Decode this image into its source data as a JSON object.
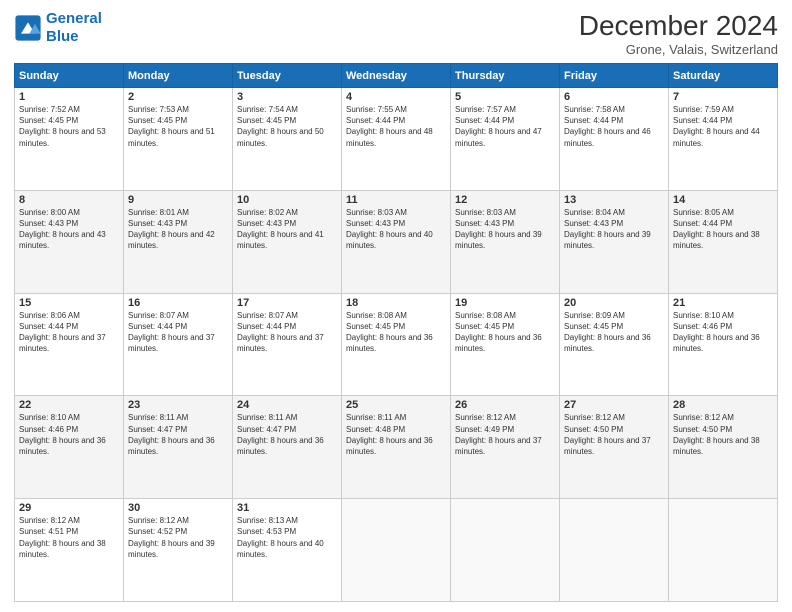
{
  "logo": {
    "line1": "General",
    "line2": "Blue"
  },
  "title": "December 2024",
  "subtitle": "Grone, Valais, Switzerland",
  "days_header": [
    "Sunday",
    "Monday",
    "Tuesday",
    "Wednesday",
    "Thursday",
    "Friday",
    "Saturday"
  ],
  "weeks": [
    [
      {
        "num": "1",
        "sunrise": "Sunrise: 7:52 AM",
        "sunset": "Sunset: 4:45 PM",
        "daylight": "Daylight: 8 hours and 53 minutes."
      },
      {
        "num": "2",
        "sunrise": "Sunrise: 7:53 AM",
        "sunset": "Sunset: 4:45 PM",
        "daylight": "Daylight: 8 hours and 51 minutes."
      },
      {
        "num": "3",
        "sunrise": "Sunrise: 7:54 AM",
        "sunset": "Sunset: 4:45 PM",
        "daylight": "Daylight: 8 hours and 50 minutes."
      },
      {
        "num": "4",
        "sunrise": "Sunrise: 7:55 AM",
        "sunset": "Sunset: 4:44 PM",
        "daylight": "Daylight: 8 hours and 48 minutes."
      },
      {
        "num": "5",
        "sunrise": "Sunrise: 7:57 AM",
        "sunset": "Sunset: 4:44 PM",
        "daylight": "Daylight: 8 hours and 47 minutes."
      },
      {
        "num": "6",
        "sunrise": "Sunrise: 7:58 AM",
        "sunset": "Sunset: 4:44 PM",
        "daylight": "Daylight: 8 hours and 46 minutes."
      },
      {
        "num": "7",
        "sunrise": "Sunrise: 7:59 AM",
        "sunset": "Sunset: 4:44 PM",
        "daylight": "Daylight: 8 hours and 44 minutes."
      }
    ],
    [
      {
        "num": "8",
        "sunrise": "Sunrise: 8:00 AM",
        "sunset": "Sunset: 4:43 PM",
        "daylight": "Daylight: 8 hours and 43 minutes."
      },
      {
        "num": "9",
        "sunrise": "Sunrise: 8:01 AM",
        "sunset": "Sunset: 4:43 PM",
        "daylight": "Daylight: 8 hours and 42 minutes."
      },
      {
        "num": "10",
        "sunrise": "Sunrise: 8:02 AM",
        "sunset": "Sunset: 4:43 PM",
        "daylight": "Daylight: 8 hours and 41 minutes."
      },
      {
        "num": "11",
        "sunrise": "Sunrise: 8:03 AM",
        "sunset": "Sunset: 4:43 PM",
        "daylight": "Daylight: 8 hours and 40 minutes."
      },
      {
        "num": "12",
        "sunrise": "Sunrise: 8:03 AM",
        "sunset": "Sunset: 4:43 PM",
        "daylight": "Daylight: 8 hours and 39 minutes."
      },
      {
        "num": "13",
        "sunrise": "Sunrise: 8:04 AM",
        "sunset": "Sunset: 4:43 PM",
        "daylight": "Daylight: 8 hours and 39 minutes."
      },
      {
        "num": "14",
        "sunrise": "Sunrise: 8:05 AM",
        "sunset": "Sunset: 4:44 PM",
        "daylight": "Daylight: 8 hours and 38 minutes."
      }
    ],
    [
      {
        "num": "15",
        "sunrise": "Sunrise: 8:06 AM",
        "sunset": "Sunset: 4:44 PM",
        "daylight": "Daylight: 8 hours and 37 minutes."
      },
      {
        "num": "16",
        "sunrise": "Sunrise: 8:07 AM",
        "sunset": "Sunset: 4:44 PM",
        "daylight": "Daylight: 8 hours and 37 minutes."
      },
      {
        "num": "17",
        "sunrise": "Sunrise: 8:07 AM",
        "sunset": "Sunset: 4:44 PM",
        "daylight": "Daylight: 8 hours and 37 minutes."
      },
      {
        "num": "18",
        "sunrise": "Sunrise: 8:08 AM",
        "sunset": "Sunset: 4:45 PM",
        "daylight": "Daylight: 8 hours and 36 minutes."
      },
      {
        "num": "19",
        "sunrise": "Sunrise: 8:08 AM",
        "sunset": "Sunset: 4:45 PM",
        "daylight": "Daylight: 8 hours and 36 minutes."
      },
      {
        "num": "20",
        "sunrise": "Sunrise: 8:09 AM",
        "sunset": "Sunset: 4:45 PM",
        "daylight": "Daylight: 8 hours and 36 minutes."
      },
      {
        "num": "21",
        "sunrise": "Sunrise: 8:10 AM",
        "sunset": "Sunset: 4:46 PM",
        "daylight": "Daylight: 8 hours and 36 minutes."
      }
    ],
    [
      {
        "num": "22",
        "sunrise": "Sunrise: 8:10 AM",
        "sunset": "Sunset: 4:46 PM",
        "daylight": "Daylight: 8 hours and 36 minutes."
      },
      {
        "num": "23",
        "sunrise": "Sunrise: 8:11 AM",
        "sunset": "Sunset: 4:47 PM",
        "daylight": "Daylight: 8 hours and 36 minutes."
      },
      {
        "num": "24",
        "sunrise": "Sunrise: 8:11 AM",
        "sunset": "Sunset: 4:47 PM",
        "daylight": "Daylight: 8 hours and 36 minutes."
      },
      {
        "num": "25",
        "sunrise": "Sunrise: 8:11 AM",
        "sunset": "Sunset: 4:48 PM",
        "daylight": "Daylight: 8 hours and 36 minutes."
      },
      {
        "num": "26",
        "sunrise": "Sunrise: 8:12 AM",
        "sunset": "Sunset: 4:49 PM",
        "daylight": "Daylight: 8 hours and 37 minutes."
      },
      {
        "num": "27",
        "sunrise": "Sunrise: 8:12 AM",
        "sunset": "Sunset: 4:50 PM",
        "daylight": "Daylight: 8 hours and 37 minutes."
      },
      {
        "num": "28",
        "sunrise": "Sunrise: 8:12 AM",
        "sunset": "Sunset: 4:50 PM",
        "daylight": "Daylight: 8 hours and 38 minutes."
      }
    ],
    [
      {
        "num": "29",
        "sunrise": "Sunrise: 8:12 AM",
        "sunset": "Sunset: 4:51 PM",
        "daylight": "Daylight: 8 hours and 38 minutes."
      },
      {
        "num": "30",
        "sunrise": "Sunrise: 8:12 AM",
        "sunset": "Sunset: 4:52 PM",
        "daylight": "Daylight: 8 hours and 39 minutes."
      },
      {
        "num": "31",
        "sunrise": "Sunrise: 8:13 AM",
        "sunset": "Sunset: 4:53 PM",
        "daylight": "Daylight: 8 hours and 40 minutes."
      },
      null,
      null,
      null,
      null
    ]
  ]
}
